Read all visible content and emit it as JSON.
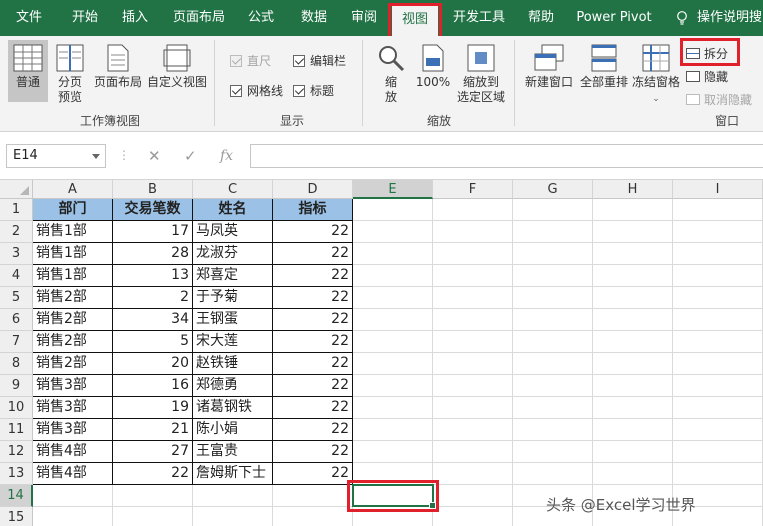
{
  "menu": {
    "tabs": [
      "文件",
      "开始",
      "插入",
      "页面布局",
      "公式",
      "数据",
      "审阅",
      "视图",
      "开发工具",
      "帮助",
      "Power Pivot",
      "操作说明搜"
    ],
    "active": "视图"
  },
  "ribbon": {
    "workbook_views": {
      "normal": "普通",
      "page_break_1": "分页",
      "page_break_2": "预览",
      "page_layout": "页面布局",
      "custom": "自定义视图",
      "label": "工作簿视图"
    },
    "show": {
      "ruler": "直尺",
      "formula_bar": "编辑栏",
      "gridlines": "网格线",
      "headings": "标题",
      "label": "显示"
    },
    "zoom": {
      "zoom_1": "缩",
      "zoom_2": "放",
      "hundred": "100%",
      "to_selection_1": "缩放到",
      "to_selection_2": "选定区域",
      "label": "缩放"
    },
    "window": {
      "new_window": "新建窗口",
      "arrange_all": "全部重排",
      "freeze_panes": "冻结窗格",
      "split": "拆分",
      "hide": "隐藏",
      "unhide": "取消隐藏",
      "label": "窗口"
    }
  },
  "formula_bar": {
    "name_box": "E14",
    "fx": "fx",
    "value": ""
  },
  "sheet": {
    "columns": [
      "A",
      "B",
      "C",
      "D",
      "E",
      "F",
      "G",
      "H",
      "I"
    ],
    "rows": [
      "1",
      "2",
      "3",
      "4",
      "5",
      "6",
      "7",
      "8",
      "9",
      "10",
      "11",
      "12",
      "13",
      "14",
      "15"
    ],
    "headers": [
      "部门",
      "交易笔数",
      "姓名",
      "指标"
    ],
    "data": [
      [
        "销售1部",
        "17",
        "马凤英",
        "22"
      ],
      [
        "销售1部",
        "28",
        "龙淑芬",
        "22"
      ],
      [
        "销售1部",
        "13",
        "郑喜定",
        "22"
      ],
      [
        "销售2部",
        "2",
        "于予菊",
        "22"
      ],
      [
        "销售2部",
        "34",
        "王钢蛋",
        "22"
      ],
      [
        "销售2部",
        "5",
        "宋大莲",
        "22"
      ],
      [
        "销售2部",
        "20",
        "赵铁锤",
        "22"
      ],
      [
        "销售3部",
        "16",
        "郑德勇",
        "22"
      ],
      [
        "销售3部",
        "19",
        "诸葛钢铁",
        "22"
      ],
      [
        "销售3部",
        "21",
        "陈小娟",
        "22"
      ],
      [
        "销售4部",
        "27",
        "王富贵",
        "22"
      ],
      [
        "销售4部",
        "22",
        "詹姆斯下士",
        "22"
      ]
    ],
    "selected_cell": "E14"
  },
  "watermark": "头条 @Excel学习世界",
  "colors": {
    "excel_green": "#217346",
    "header_fill": "#9bc2e6",
    "highlight_red": "#e0202a"
  }
}
